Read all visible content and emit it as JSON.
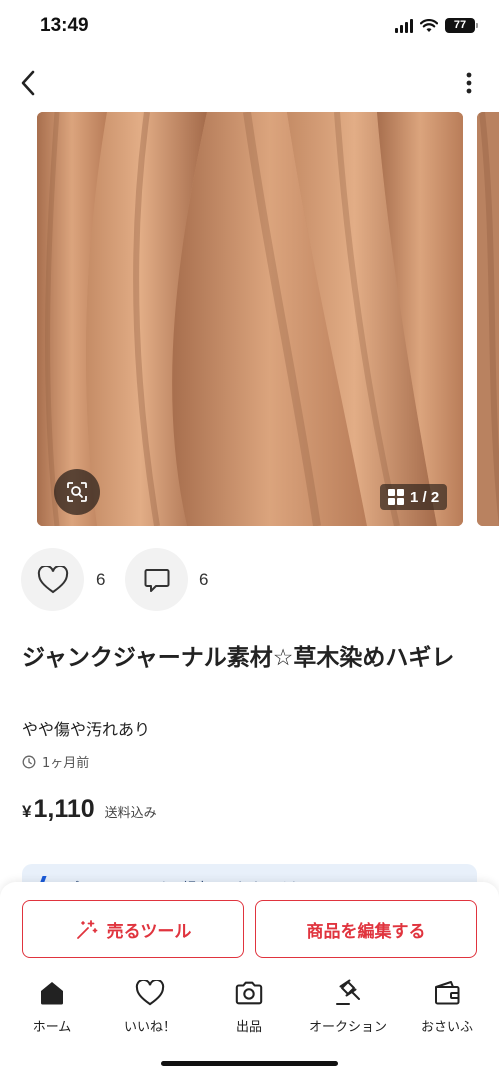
{
  "status_bar": {
    "time": "13:49",
    "battery": "77",
    "icons": [
      "signal-icon",
      "wifi-icon",
      "battery-icon"
    ]
  },
  "nav": {
    "back_icon": "chevron-left-icon",
    "more_icon": "more-vertical-icon"
  },
  "gallery": {
    "page_indicator": "1 / 2",
    "current_page": 1,
    "total_pages": 2,
    "lens_icon": "image-search-icon",
    "grid_icon": "grid-icon"
  },
  "reactions": {
    "likes": "6",
    "comments": "6",
    "like_icon": "heart-icon",
    "comment_icon": "comment-icon"
  },
  "item": {
    "title": "ジャンクジャーナル素材☆草木染めハギレ",
    "condition": "やや傷や汚れあり",
    "posted": "1ヶ月前",
    "price_yen": "¥",
    "price": "1,110",
    "price_note": "送料込み"
  },
  "banner": {
    "text": "プロフェッショナル認定　でもオリジナル"
  },
  "actions": {
    "sell_tool": "売るツール",
    "edit_item": "商品を編集する",
    "sell_tool_icon": "sparkle-icon"
  },
  "tabs": [
    {
      "label": "ホーム",
      "icon": "home-icon"
    },
    {
      "label": "いいね！",
      "icon": "heart-icon"
    },
    {
      "label": "出品",
      "icon": "camera-icon"
    },
    {
      "label": "オークション",
      "icon": "gavel-icon"
    },
    {
      "label": "おさいふ",
      "icon": "wallet-icon"
    }
  ],
  "colors": {
    "accent": "#e0343e",
    "photo": "#c98f69",
    "banner": "#e8f0fa"
  }
}
